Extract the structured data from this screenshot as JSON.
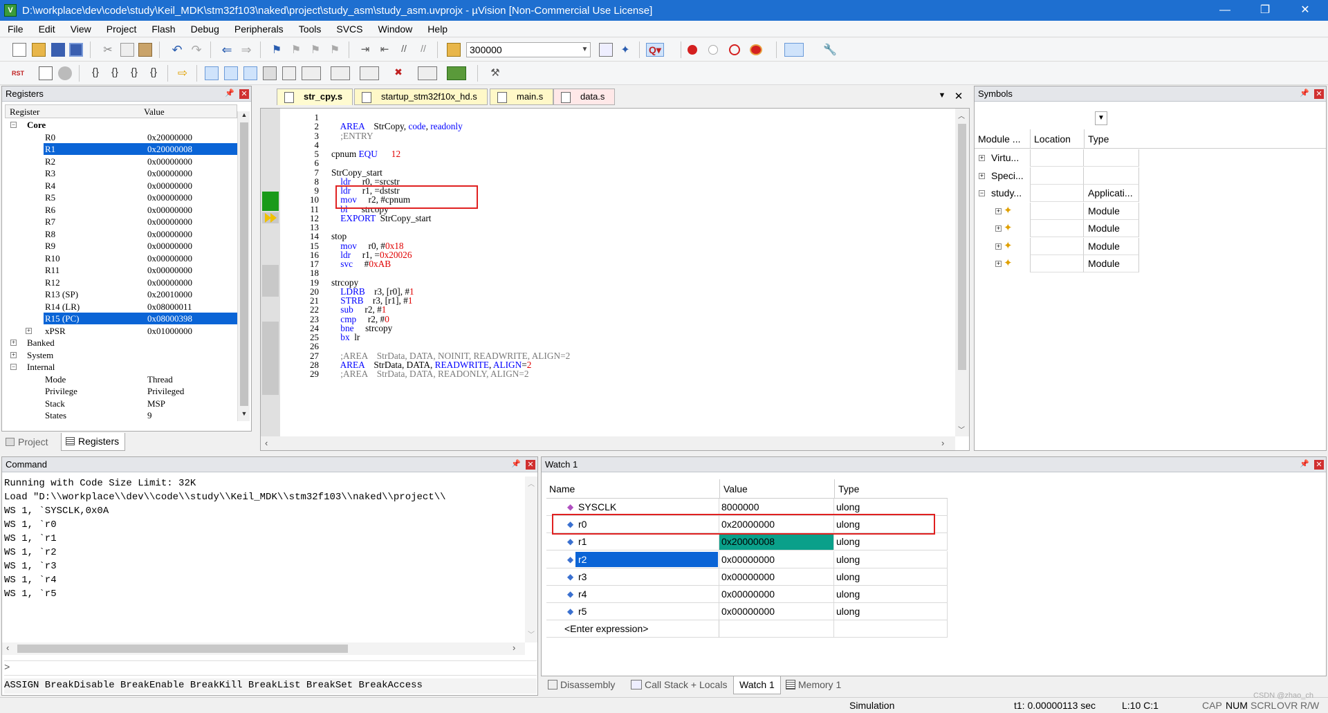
{
  "window": {
    "title": "D:\\workplace\\dev\\code\\study\\Keil_MDK\\stm32f103\\naked\\project\\study_asm\\study_asm.uvprojx - µVision  [Non-Commercial Use License]",
    "minimize": "—",
    "restore": "❐",
    "close": "✕"
  },
  "menu": [
    "File",
    "Edit",
    "View",
    "Project",
    "Flash",
    "Debug",
    "Peripherals",
    "Tools",
    "SVCS",
    "Window",
    "Help"
  ],
  "toolbar": {
    "run_count": "300000"
  },
  "registers": {
    "title": "Registers",
    "col_register": "Register",
    "col_value": "Value",
    "core_label": "Core",
    "rows": [
      {
        "name": "R0",
        "value": "0x20000000"
      },
      {
        "name": "R1",
        "value": "0x20000008"
      },
      {
        "name": "R2",
        "value": "0x00000000"
      },
      {
        "name": "R3",
        "value": "0x00000000"
      },
      {
        "name": "R4",
        "value": "0x00000000"
      },
      {
        "name": "R5",
        "value": "0x00000000"
      },
      {
        "name": "R6",
        "value": "0x00000000"
      },
      {
        "name": "R7",
        "value": "0x00000000"
      },
      {
        "name": "R8",
        "value": "0x00000000"
      },
      {
        "name": "R9",
        "value": "0x00000000"
      },
      {
        "name": "R10",
        "value": "0x00000000"
      },
      {
        "name": "R11",
        "value": "0x00000000"
      },
      {
        "name": "R12",
        "value": "0x00000000"
      },
      {
        "name": "R13 (SP)",
        "value": "0x20010000"
      },
      {
        "name": "R14 (LR)",
        "value": "0x08000011"
      },
      {
        "name": "R15 (PC)",
        "value": "0x08000398"
      },
      {
        "name": "xPSR",
        "value": "0x01000000"
      }
    ],
    "groups": [
      "Banked",
      "System",
      "Internal"
    ],
    "internal": [
      {
        "name": "Mode",
        "value": "Thread"
      },
      {
        "name": "Privilege",
        "value": "Privileged"
      },
      {
        "name": "Stack",
        "value": "MSP"
      },
      {
        "name": "States",
        "value": "9"
      }
    ],
    "tab_project": "Project",
    "tab_registers": "Registers"
  },
  "editor": {
    "tabs": [
      "str_cpy.s",
      "startup_stm32f10x_hd.s",
      "main.s",
      "data.s"
    ],
    "lines": [
      {
        "n": "1",
        "t": []
      },
      {
        "n": "2",
        "t": [
          [
            "    ",
            ""
          ],
          [
            "AREA",
            "kw"
          ],
          [
            "    StrCopy, ",
            ""
          ],
          [
            "code",
            "kw"
          ],
          [
            ", ",
            ""
          ],
          [
            "readonly",
            "kw"
          ]
        ]
      },
      {
        "n": "3",
        "t": [
          [
            "    ;ENTRY",
            "cmt"
          ]
        ]
      },
      {
        "n": "4",
        "t": []
      },
      {
        "n": "5",
        "t": [
          [
            "cpnum ",
            ""
          ],
          [
            "EQU",
            "kw"
          ],
          [
            "      ",
            ""
          ],
          [
            "12",
            "num"
          ]
        ]
      },
      {
        "n": "6",
        "t": []
      },
      {
        "n": "7",
        "t": [
          [
            "StrCopy_start",
            ""
          ]
        ]
      },
      {
        "n": "8",
        "t": [
          [
            "    ",
            ""
          ],
          [
            "ldr",
            "kw"
          ],
          [
            "     r0, =srcstr",
            ""
          ]
        ]
      },
      {
        "n": "9",
        "t": [
          [
            "    ",
            ""
          ],
          [
            "ldr",
            "kw"
          ],
          [
            "     r1, =dststr",
            ""
          ]
        ]
      },
      {
        "n": "10",
        "t": [
          [
            "    ",
            ""
          ],
          [
            "mov",
            "kw"
          ],
          [
            "     r2, #cpnum",
            ""
          ]
        ]
      },
      {
        "n": "11",
        "t": [
          [
            "    ",
            ""
          ],
          [
            "bl",
            "kw"
          ],
          [
            "      strcopy",
            ""
          ]
        ]
      },
      {
        "n": "12",
        "t": [
          [
            "    ",
            ""
          ],
          [
            "EXPORT",
            "kw"
          ],
          [
            "  StrCopy_start",
            ""
          ]
        ]
      },
      {
        "n": "13",
        "t": []
      },
      {
        "n": "14",
        "t": [
          [
            "stop",
            ""
          ]
        ]
      },
      {
        "n": "15",
        "t": [
          [
            "    ",
            ""
          ],
          [
            "mov",
            "kw"
          ],
          [
            "     r0, #",
            ""
          ],
          [
            "0x18",
            "num"
          ]
        ]
      },
      {
        "n": "16",
        "t": [
          [
            "    ",
            ""
          ],
          [
            "ldr",
            "kw"
          ],
          [
            "     r1, =",
            ""
          ],
          [
            "0x20026",
            "num"
          ]
        ]
      },
      {
        "n": "17",
        "t": [
          [
            "    ",
            ""
          ],
          [
            "svc",
            "kw"
          ],
          [
            "     #",
            ""
          ],
          [
            "0xAB",
            "num"
          ]
        ]
      },
      {
        "n": "18",
        "t": []
      },
      {
        "n": "19",
        "t": [
          [
            "strcopy",
            ""
          ]
        ]
      },
      {
        "n": "20",
        "t": [
          [
            "    ",
            ""
          ],
          [
            "LDRB",
            "kw"
          ],
          [
            "    r3, [r0], #",
            ""
          ],
          [
            "1",
            "num"
          ]
        ]
      },
      {
        "n": "21",
        "t": [
          [
            "    ",
            ""
          ],
          [
            "STRB",
            "kw"
          ],
          [
            "    r3, [r1], #",
            ""
          ],
          [
            "1",
            "num"
          ]
        ]
      },
      {
        "n": "22",
        "t": [
          [
            "    ",
            ""
          ],
          [
            "sub",
            "kw"
          ],
          [
            "     r2, #",
            ""
          ],
          [
            "1",
            "num"
          ]
        ]
      },
      {
        "n": "23",
        "t": [
          [
            "    ",
            ""
          ],
          [
            "cmp",
            "kw"
          ],
          [
            "     r2, #",
            ""
          ],
          [
            "0",
            "num"
          ]
        ]
      },
      {
        "n": "24",
        "t": [
          [
            "    ",
            ""
          ],
          [
            "bne",
            "kw"
          ],
          [
            "     strcopy",
            ""
          ]
        ]
      },
      {
        "n": "25",
        "t": [
          [
            "    ",
            ""
          ],
          [
            "bx",
            "kw"
          ],
          [
            "  lr",
            ""
          ]
        ]
      },
      {
        "n": "26",
        "t": []
      },
      {
        "n": "27",
        "t": [
          [
            "    ;AREA    StrData, DATA, NOINIT, READWRITE, ALIGN=2",
            "cmt"
          ]
        ]
      },
      {
        "n": "28",
        "t": [
          [
            "    ",
            ""
          ],
          [
            "AREA",
            "kw"
          ],
          [
            "    StrData, DATA, ",
            ""
          ],
          [
            "READWRITE",
            "kw"
          ],
          [
            ", ",
            ""
          ],
          [
            "ALIGN",
            "kw"
          ],
          [
            "=",
            ""
          ],
          [
            "2",
            "num"
          ]
        ]
      },
      {
        "n": "29",
        "t": [
          [
            "    ;AREA    StrData, DATA, READONLY, ALIGN=2",
            "cmt"
          ]
        ]
      }
    ]
  },
  "symbols": {
    "title": "Symbols",
    "col_module": "Module ...",
    "col_location": "Location",
    "col_type": "Type",
    "rows": [
      {
        "name": "Virtu...",
        "location": "",
        "type": ""
      },
      {
        "name": "Speci...",
        "location": "",
        "type": ""
      },
      {
        "name": "study...",
        "location": "",
        "type": "Applicati..."
      },
      {
        "name": "",
        "location": "",
        "type": "Module"
      },
      {
        "name": "",
        "location": "",
        "type": "Module"
      },
      {
        "name": "",
        "location": "",
        "type": "Module"
      },
      {
        "name": "",
        "location": "",
        "type": "Module"
      }
    ]
  },
  "command": {
    "title": "Command",
    "lines": [
      "Running with Code Size Limit: 32K",
      "Load \"D:\\\\workplace\\\\dev\\\\code\\\\study\\\\Keil_MDK\\\\stm32f103\\\\naked\\\\project\\\\",
      "WS 1, `SYSCLK,0x0A",
      "WS 1, `r0",
      "WS 1, `r1",
      "WS 1, `r2",
      "WS 1, `r3",
      "WS 1, `r4",
      "WS 1, `r5"
    ],
    "prompt": ">",
    "hint": "ASSIGN BreakDisable BreakEnable BreakKill BreakList BreakSet BreakAccess"
  },
  "watch": {
    "title": "Watch 1",
    "col_name": "Name",
    "col_value": "Value",
    "col_type": "Type",
    "rows": [
      {
        "name": "SYSCLK",
        "value": "8000000",
        "type": "ulong"
      },
      {
        "name": "r0",
        "value": "0x20000000",
        "type": "ulong"
      },
      {
        "name": "r1",
        "value": "0x20000008",
        "type": "ulong"
      },
      {
        "name": "r2",
        "value": "0x00000000",
        "type": "ulong"
      },
      {
        "name": "r3",
        "value": "0x00000000",
        "type": "ulong"
      },
      {
        "name": "r4",
        "value": "0x00000000",
        "type": "ulong"
      },
      {
        "name": "r5",
        "value": "0x00000000",
        "type": "ulong"
      }
    ],
    "enter_expression": "<Enter expression>",
    "tabs": [
      "Disassembly",
      "Call Stack + Locals",
      "Watch 1",
      "Memory 1"
    ]
  },
  "status": {
    "mode": "Simulation",
    "time": "t1: 0.00000113 sec",
    "cursor": "L:10 C:1",
    "cap": "CAP",
    "num": "NUM",
    "scrl": "SCRL",
    "ovr": "OVR",
    "rw": "R/W",
    "watermark": "CSDN @zhao_ch"
  }
}
